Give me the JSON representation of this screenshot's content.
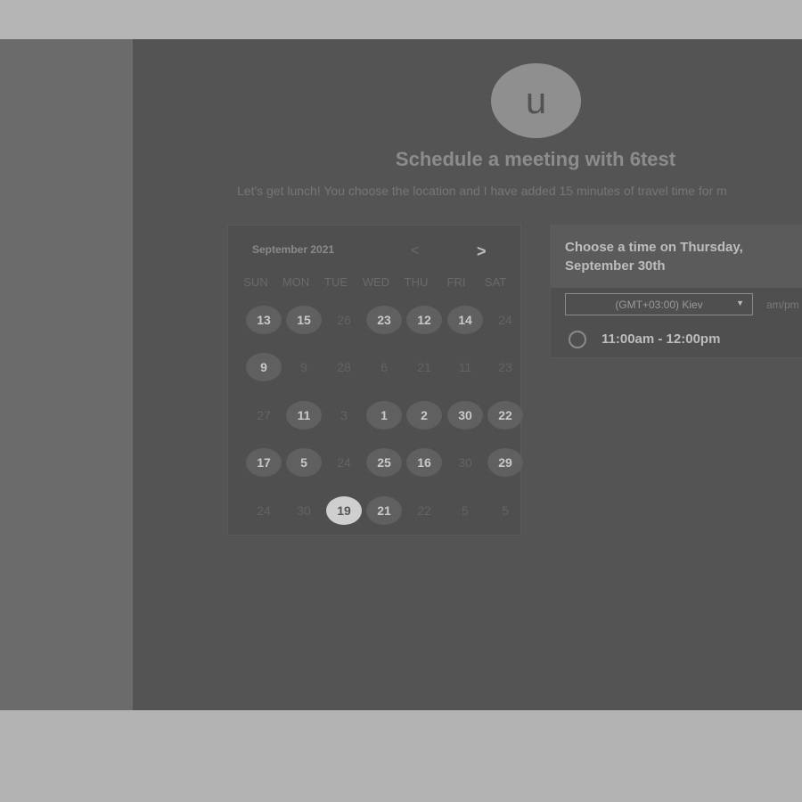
{
  "header": {
    "avatar_letter": "u",
    "title": "Schedule a meeting with 6test",
    "description": "Let's get lunch! You choose the location and I have added 15 minutes of travel time for m"
  },
  "calendar": {
    "month_label": "September 2021",
    "prev_icon": "chevron-left-icon",
    "next_icon": "chevron-right-icon",
    "weekdays": [
      "SUN",
      "MON",
      "TUE",
      "WED",
      "THU",
      "FRI",
      "SAT"
    ],
    "weeks": [
      [
        {
          "day": "13",
          "state": "available"
        },
        {
          "day": "15",
          "state": "available"
        },
        {
          "day": "26",
          "state": "muted"
        },
        {
          "day": "23",
          "state": "available"
        },
        {
          "day": "12",
          "state": "available"
        },
        {
          "day": "14",
          "state": "available"
        },
        {
          "day": "24",
          "state": "muted"
        }
      ],
      [
        {
          "day": "9",
          "state": "available"
        },
        {
          "day": "9",
          "state": "muted"
        },
        {
          "day": "28",
          "state": "muted"
        },
        {
          "day": "6",
          "state": "muted"
        },
        {
          "day": "21",
          "state": "muted"
        },
        {
          "day": "11",
          "state": "muted"
        },
        {
          "day": "23",
          "state": "muted"
        }
      ],
      [
        {
          "day": "27",
          "state": "muted"
        },
        {
          "day": "11",
          "state": "available"
        },
        {
          "day": "3",
          "state": "muted"
        },
        {
          "day": "1",
          "state": "available"
        },
        {
          "day": "2",
          "state": "available"
        },
        {
          "day": "30",
          "state": "available"
        },
        {
          "day": "22",
          "state": "available"
        }
      ],
      [
        {
          "day": "17",
          "state": "available"
        },
        {
          "day": "5",
          "state": "available"
        },
        {
          "day": "24",
          "state": "muted"
        },
        {
          "day": "25",
          "state": "available"
        },
        {
          "day": "16",
          "state": "available"
        },
        {
          "day": "30",
          "state": "muted"
        },
        {
          "day": "29",
          "state": "available"
        }
      ],
      [
        {
          "day": "24",
          "state": "muted"
        },
        {
          "day": "30",
          "state": "muted"
        },
        {
          "day": "19",
          "state": "selected"
        },
        {
          "day": "21",
          "state": "available"
        },
        {
          "day": "22",
          "state": "muted"
        },
        {
          "day": "5",
          "state": "muted"
        },
        {
          "day": "5",
          "state": "muted"
        }
      ]
    ]
  },
  "time_panel": {
    "heading": "Choose a time on Thursday, September 30th",
    "timezone": "(GMT+03:00) Kiev",
    "format_toggle": "am/pm",
    "slots": [
      {
        "label": "11:00am - 12:00pm"
      }
    ]
  },
  "colors": {
    "background": "#545454",
    "left_panel": "#6b6b6b",
    "available_day": "#606060",
    "selected_day": "#cfcfcf"
  }
}
